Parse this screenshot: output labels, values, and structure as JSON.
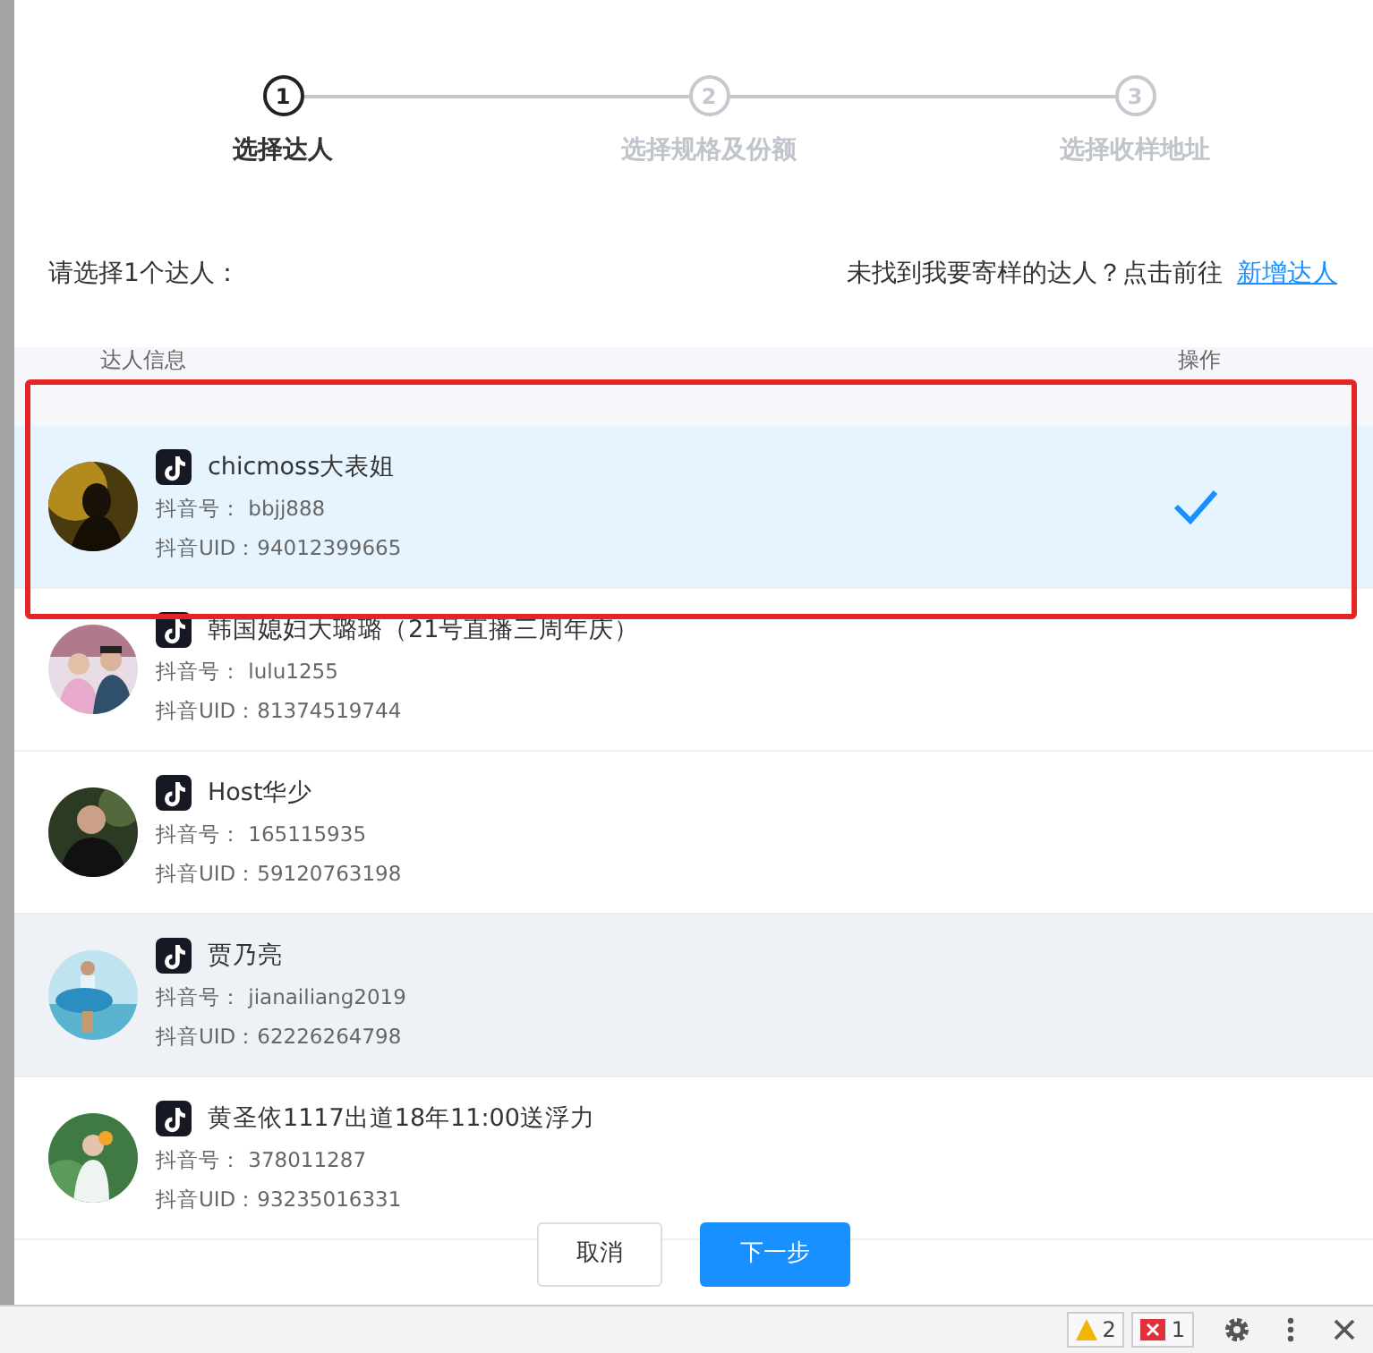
{
  "steps": [
    {
      "number": "1",
      "label": "选择达人",
      "selected": true
    },
    {
      "number": "2",
      "label": "选择规格及份额",
      "selected": false
    },
    {
      "number": "3",
      "label": "选择收样地址",
      "selected": false
    }
  ],
  "prompt": "请选择1个达人：",
  "hint": "未找到我要寄样的达人？点击前往",
  "add_link": "新增达人",
  "table": {
    "columns": [
      "达人信息",
      "操作"
    ],
    "rows": [
      {
        "name": "chicmoss大表姐",
        "account_label": "抖音号：",
        "account": "bbjj888",
        "uid_label": "抖音UID：",
        "uid": "94012399665",
        "selected": true,
        "hovered": false
      },
      {
        "name": "韩国媳妇大璐璐（21号直播三周年庆）",
        "account_label": "抖音号：",
        "account": "lulu1255",
        "uid_label": "抖音UID：",
        "uid": "81374519744",
        "selected": false,
        "hovered": false
      },
      {
        "name": "Host华少",
        "account_label": "抖音号：",
        "account": "165115935",
        "uid_label": "抖音UID：",
        "uid": "59120763198",
        "selected": false,
        "hovered": false
      },
      {
        "name": "贾乃亮",
        "account_label": "抖音号：",
        "account": "jianailiang2019",
        "uid_label": "抖音UID：",
        "uid": "62226264798",
        "selected": false,
        "hovered": true
      },
      {
        "name": "黄圣依1117出道18年11:00送浮力",
        "account_label": "抖音号：",
        "account": "378011287",
        "uid_label": "抖音UID：",
        "uid": "93235016331",
        "selected": false,
        "hovered": false
      }
    ]
  },
  "buttons": {
    "cancel": "取消",
    "next": "下一步"
  },
  "devtools": {
    "warnings": "2",
    "errors": "1"
  }
}
